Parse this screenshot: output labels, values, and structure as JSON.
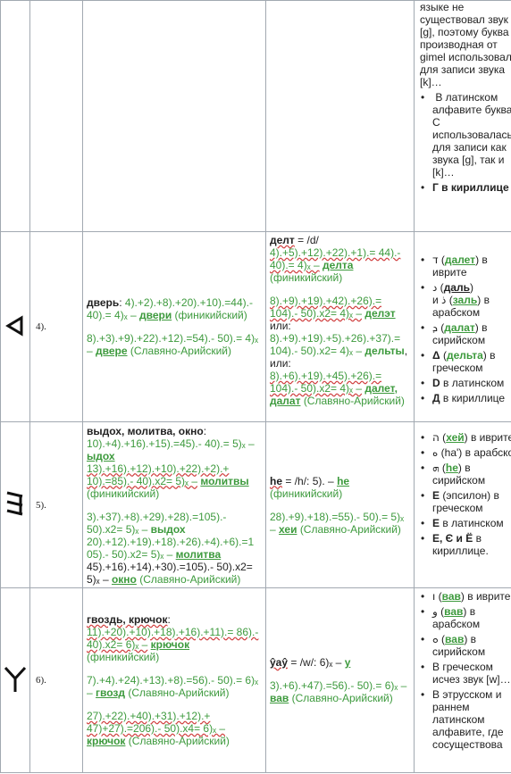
{
  "rows": [
    {
      "id": "gimel-tail",
      "ot": [
        "языке не существовал звук [g], поэтому буква С, производная от gimel использовала для записи звука [k]…",
        "В латинском алфавите буква C использовалась для записи как звука [g], так и [k]…",
        "Г в кириллице"
      ]
    },
    {
      "id": "dalet",
      "num": "4).",
      "ex_word": "дверь",
      "ex1": "4).+2).+8).+20).+10).=44).- 40).= 4)ₓ –",
      "ex1_word": "двери",
      "ex1_src": "(финикийский)",
      "ex2": "8).+3).+9).+22).+12).=54).- 50).= 4)ₓ –",
      "ex2_word": "двере",
      "ex2_src": "(Славяно-Арийский)",
      "ph_word": "делт",
      "ph_ipa": "= /d/",
      "ph1": "4).+5).+12).+22).+1).= 44).- 40).= 4)ₓ –",
      "ph1_word": "делта",
      "ph1_src": "(финикийский)",
      "ph2": "8).+9).+19).+42).+26).= 104).- 50).x2= 4)ₓ –",
      "ph2_word": "делэт",
      "ph2_or": "или:",
      "ph3": "8).+9).+19).+5).+26).+37).= 104).- 50).x2= 4)ₓ –",
      "ph3_word": "дельты",
      "ph3_or": ", или:",
      "ph4": "8).+6).+19).+45).+26).= 104).- 50).x2= 4)ₓ –",
      "ph4_word": "далет, далат",
      "ph4_src": "(Славяно-Арийский)",
      "ot": [
        {
          "glyph": "ד",
          "name": "далет",
          "rest": "в иврите"
        },
        {
          "glyph": "د",
          "name": "даль",
          "glyph2": "ذ",
          "name2": "заль",
          "rest": "в арабском"
        },
        {
          "glyph": "ܕ",
          "name": "далат",
          "rest": "в сирийском"
        },
        {
          "glyph": "Δ",
          "name": "дельта",
          "rest": "в греческом"
        },
        {
          "glyph": "D",
          "rest": "в латинском"
        },
        {
          "glyph": "Д",
          "rest": "в кириллице"
        }
      ]
    },
    {
      "id": "he",
      "num": "5).",
      "ex_words": "выдох, молитва, окно",
      "ex1": "10).+4).+16).+15).=45).- 40).= 5)ₓ –",
      "ex1_word": "ыдох",
      "ex2": "13).+16).+12).+10).+22).+2).+ 10).=85).- 40).x2= 5)ₓ –",
      "ex2_word": "молитвы",
      "ex2_src": "(финикийский)",
      "ex3": "3).+37).+8).+29).+28).=105).- 50).x2= 5)ₓ –",
      "ex3_word": "выдох",
      "ex4": "20).+12).+19).+18).+26).+4).+6).=1 05).- 50).x2= 5)ₓ –",
      "ex4_word": "молитва",
      "ex5": "45).+16).+14).+30).=105).- 50).x2= 5)ₓ –",
      "ex5_word": "окно",
      "ex5_src": "(Славяно-Арийский)",
      "ph_word": "he",
      "ph_ipa": "= /h/: 5).",
      "ph_word2": "he",
      "ph_src": "(финикийский)",
      "ph2": "28).+9).+18).=55).- 50).= 5)ₓ –",
      "ph2_word": "хеи",
      "ph2_src": "(Славяно-Арийский)",
      "ot": [
        {
          "glyph": "ה",
          "name": "хей",
          "rest": "в иврите"
        },
        {
          "glyph": "ه",
          "name": "ha'",
          "rest": "в арабском"
        },
        {
          "glyph": "ܗ",
          "name": "he",
          "rest": "в сирийском"
        },
        {
          "glyph": "Ε",
          "plain": "(эпсилон)",
          "rest": "в греческом"
        },
        {
          "glyph": "E",
          "rest": "в латинском"
        },
        {
          "glyph": "Е, Є и Ё",
          "rest": "в кириллице."
        }
      ]
    },
    {
      "id": "waw",
      "num": "6).",
      "ex_words": "гвоздь, крючок",
      "ex1": "11).+20).+10).+18).+16).+11).= 86).- 40).x2= 6)ₓ –",
      "ex1_word": "крючок",
      "ex1_src": "(финикийский)",
      "ex2": "7).+4).+24).+13).+8).=56).- 50).= 6)ₓ –",
      "ex2_word": "гвозд",
      "ex2_src": "(Славяно-Арийский)",
      "ex3": "27).+22).+40).+31).+12).+ 47)+27).=206).- 50).x4= 6)ₓ –",
      "ex3_word": "крючок",
      "ex3_src": "(Славяно-Арийский)",
      "ph_word": "ŷaŷ",
      "ph_ipa": "= /w/: 6)ₓ –",
      "ph_word2": "у",
      "ph2": "3).+6).+47).=56).- 50).= 6)ₓ –",
      "ph2_word": "вав",
      "ph2_src": "(Славяно-Арийский)",
      "ot": [
        {
          "glyph": "ו",
          "name": "вав",
          "rest": "в иврите"
        },
        {
          "glyph": "و",
          "name": "вав",
          "rest": "в арабском"
        },
        {
          "glyph": "ܘ",
          "name": "вав",
          "rest": "в сирийском"
        },
        {
          "text": "В греческом исчез звук [w]…"
        },
        {
          "text": "В этрусском и раннем латинском алфавите, где сосуществова"
        }
      ]
    }
  ]
}
